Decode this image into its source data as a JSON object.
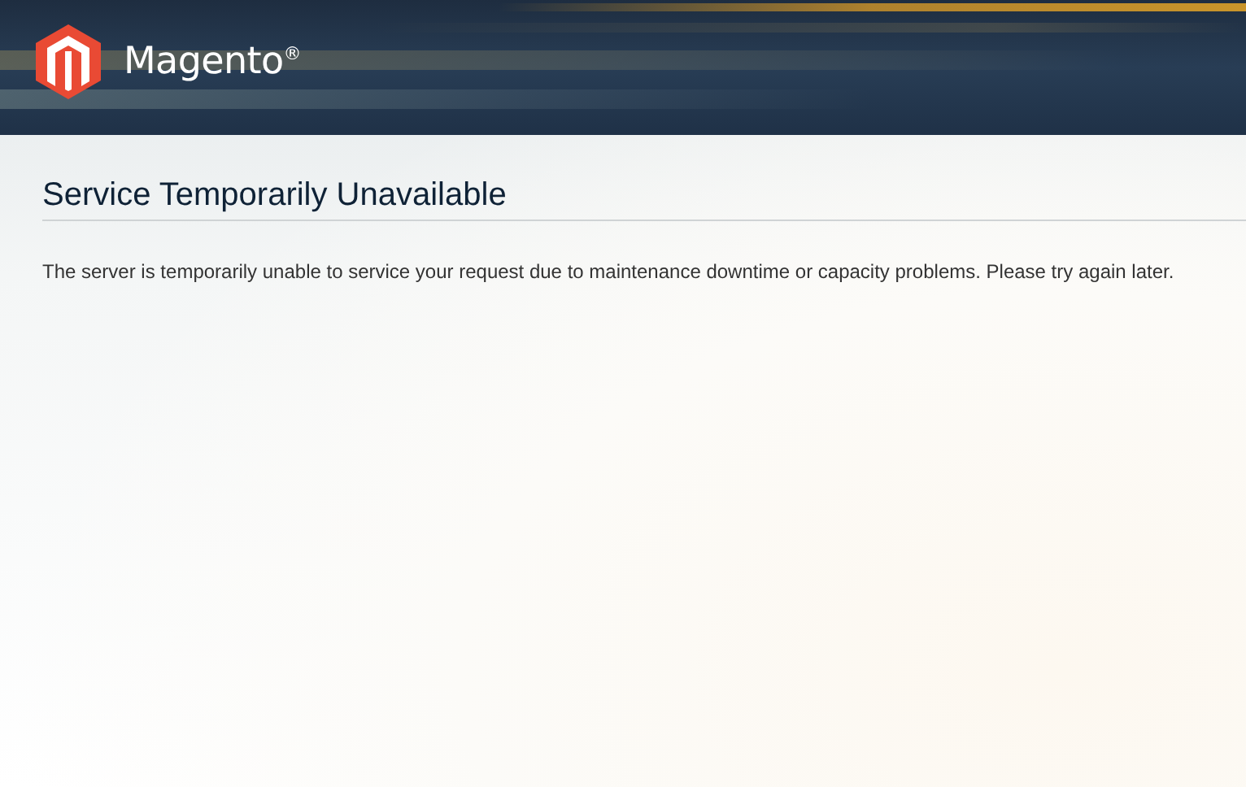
{
  "header": {
    "brand": "Magento$^{®}$"
  },
  "page": {
    "title": "Service Temporarily Unavailable",
    "message": "The server is temporarily unable to service your request due to maintenance downtime or capacity problems. Please try again later."
  }
}
